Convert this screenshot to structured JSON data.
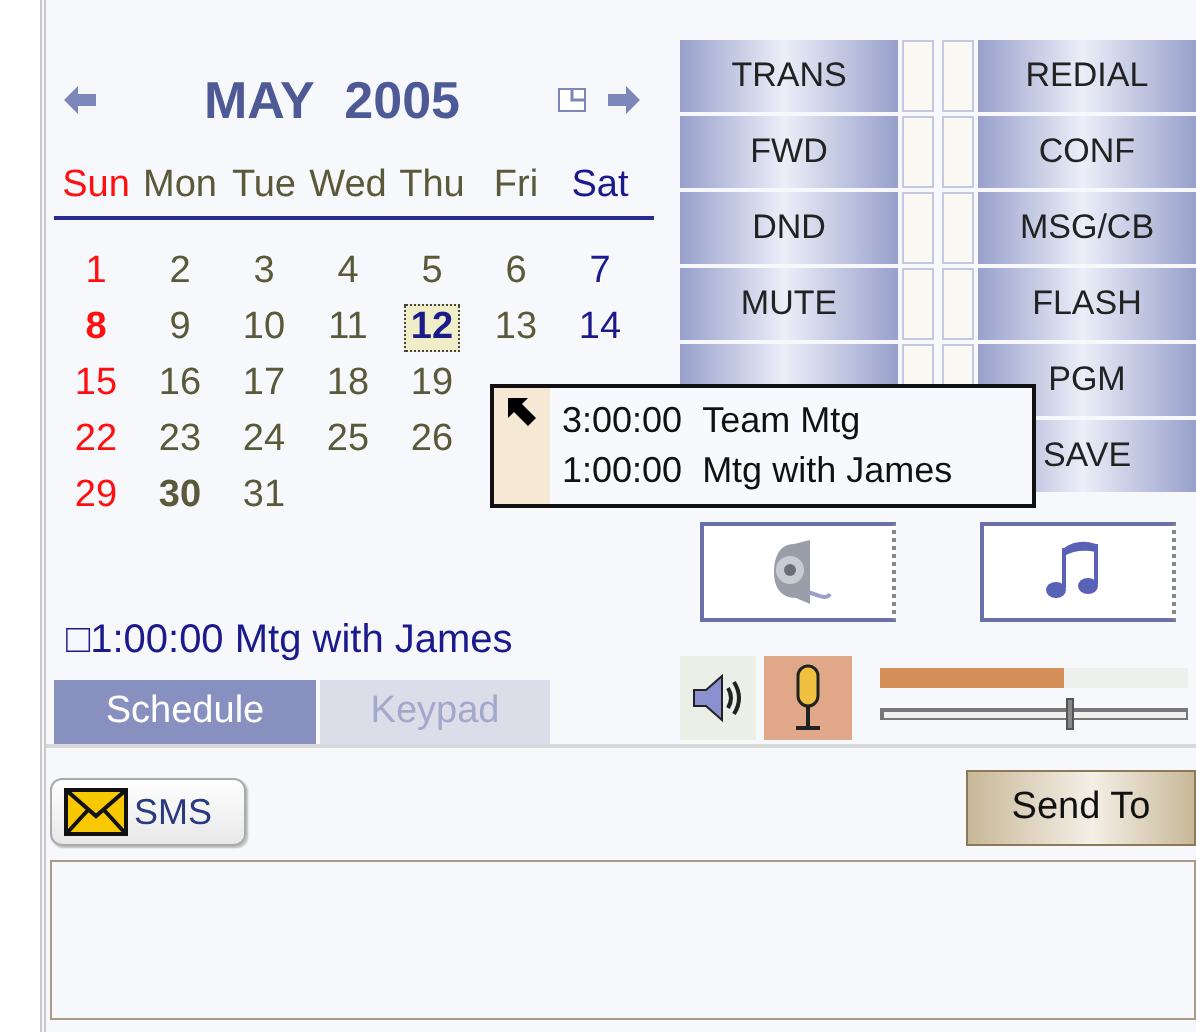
{
  "calendar": {
    "month": "MAY",
    "year": "2005",
    "weekdays": [
      {
        "text": "Sun",
        "color": "#ff1010"
      },
      {
        "text": "Mon",
        "color": "#5a5a3a"
      },
      {
        "text": "Tue",
        "color": "#5a5a3a"
      },
      {
        "text": "Wed",
        "color": "#5a5a3a"
      },
      {
        "text": "Thu",
        "color": "#5a5a3a"
      },
      {
        "text": "Fri",
        "color": "#5a5a3a"
      },
      {
        "text": "Sat",
        "color": "#1a1a8c"
      }
    ],
    "weeks": [
      [
        {
          "text": "1",
          "bold": false,
          "selected": false
        },
        {
          "text": "2",
          "bold": false,
          "selected": false
        },
        {
          "text": "3",
          "bold": false,
          "selected": false
        },
        {
          "text": "4",
          "bold": false,
          "selected": false
        },
        {
          "text": "5",
          "bold": false,
          "selected": false
        },
        {
          "text": "6",
          "bold": false,
          "selected": false
        },
        {
          "text": "7",
          "bold": false,
          "selected": false
        }
      ],
      [
        {
          "text": "8",
          "bold": true,
          "selected": false
        },
        {
          "text": "9",
          "bold": false,
          "selected": false
        },
        {
          "text": "10",
          "bold": false,
          "selected": false
        },
        {
          "text": "11",
          "bold": false,
          "selected": false
        },
        {
          "text": "12",
          "bold": true,
          "selected": true
        },
        {
          "text": "13",
          "bold": false,
          "selected": false
        },
        {
          "text": "14",
          "bold": false,
          "selected": false
        }
      ],
      [
        {
          "text": "15",
          "bold": false,
          "selected": false
        },
        {
          "text": "16",
          "bold": false,
          "selected": false
        },
        {
          "text": "17",
          "bold": false,
          "selected": false
        },
        {
          "text": "18",
          "bold": false,
          "selected": false
        },
        {
          "text": "19",
          "bold": false,
          "selected": false
        }
      ],
      [
        {
          "text": "22",
          "bold": false,
          "selected": false
        },
        {
          "text": "23",
          "bold": false,
          "selected": false
        },
        {
          "text": "24",
          "bold": false,
          "selected": false
        },
        {
          "text": "25",
          "bold": false,
          "selected": false
        },
        {
          "text": "26",
          "bold": false,
          "selected": false
        }
      ],
      [
        {
          "text": "29",
          "bold": false,
          "selected": false
        },
        {
          "text": "30",
          "bold": true,
          "selected": false
        },
        {
          "text": "31",
          "bold": false,
          "selected": false
        }
      ]
    ]
  },
  "event_line": "□1:00:00 Mtg with James",
  "tabs": [
    {
      "label": "Schedule",
      "selected": true
    },
    {
      "label": "Keypad",
      "selected": false
    }
  ],
  "keys_left": [
    "TRANS",
    "FWD",
    "DND",
    "MUTE"
  ],
  "keys_right": [
    "REDIAL",
    "CONF",
    "MSG/CB",
    "FLASH",
    "PGM",
    "SAVE"
  ],
  "mic": {
    "on": true
  },
  "input_meter": {
    "level": 0.6
  },
  "volume": {
    "level": 0.62
  },
  "tooltip": {
    "lines": [
      {
        "time": "3:00:00",
        "title": "Team Mtg"
      },
      {
        "time": "1:00:00",
        "title": "Mtg with James"
      }
    ]
  },
  "sms_button": "SMS",
  "send_button": "Send To"
}
